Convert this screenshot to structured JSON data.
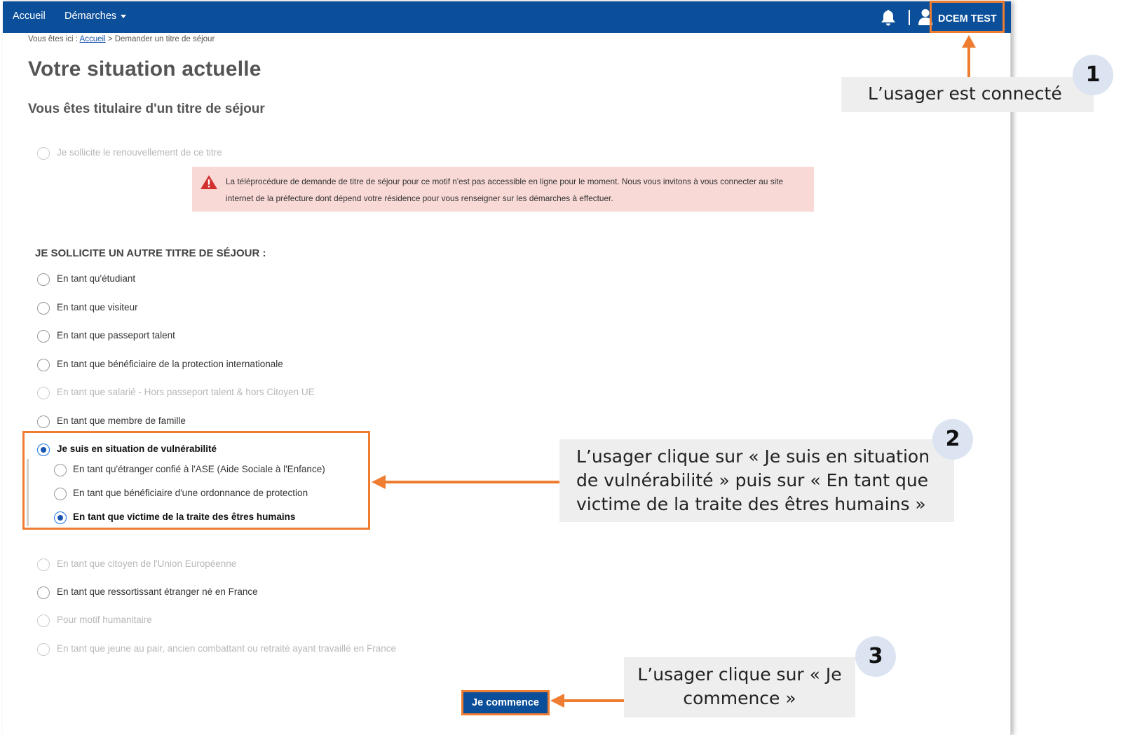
{
  "nav": {
    "accueil": "Accueil",
    "demarches": "Démarches",
    "user_name": "DCEM TEST"
  },
  "breadcrumb": {
    "prefix": "Vous êtes ici :",
    "home_link": "Accueil",
    "current": "> Demander un titre de séjour"
  },
  "page_title": "Votre situation actuelle",
  "section_title": "Vous êtes titulaire d'un titre de séjour",
  "renewal_option": "Je sollicite le renouvellement de ce titre",
  "alert_text": "La téléprocédure de demande de titre de séjour pour ce motif n'est pas accessible en ligne pour le moment. Nous vous invitons à vous connecter au site internet de la préfecture dont dépend votre résidence pour vous renseigner sur les démarches à effectuer.",
  "other_title": "JE SOLLICITE UN AUTRE TITRE DE SÉJOUR :",
  "options": [
    {
      "label": "En tant qu'étudiant",
      "state": "enabled"
    },
    {
      "label": "En tant que visiteur",
      "state": "enabled"
    },
    {
      "label": "En tant que passeport talent",
      "state": "enabled"
    },
    {
      "label": "En tant que bénéficiaire de la protection internationale",
      "state": "enabled"
    },
    {
      "label": "En tant que salarié - Hors passeport talent & hors Citoyen UE",
      "state": "disabled"
    },
    {
      "label": "En tant que membre de famille",
      "state": "enabled"
    },
    {
      "label": "Je suis en situation de vulnérabilité",
      "state": "checked"
    }
  ],
  "sub_options": [
    {
      "label": "En tant qu'étranger confié à l'ASE (Aide Sociale à l'Enfance)",
      "state": "enabled"
    },
    {
      "label": "En tant que bénéficiaire d'une ordonnance de protection",
      "state": "enabled"
    },
    {
      "label": "En tant que victime de la traite des êtres humains",
      "state": "checked"
    }
  ],
  "options_after": [
    {
      "label": "En tant que citoyen de l'Union Européenne",
      "state": "disabled"
    },
    {
      "label": "En tant que ressortissant étranger né en France",
      "state": "enabled"
    },
    {
      "label": "Pour motif humanitaire",
      "state": "disabled"
    },
    {
      "label": "En tant que jeune au pair, ancien combattant ou retraité ayant travaillé en France",
      "state": "disabled"
    }
  ],
  "start_button": "Je commence",
  "annotations": {
    "callout_1": "L’usager est connecté",
    "badge_1": "1",
    "callout_2_line1": "L’usager clique sur « Je suis en situation",
    "callout_2_line2": "de vulnérabilité » puis sur « En tant que",
    "callout_2_line3": "victime de la traite des êtres humains »",
    "badge_2": "2",
    "callout_3_line1": "L’usager clique sur « Je",
    "callout_3_line2": "commence »",
    "badge_3": "3"
  },
  "colors": {
    "navbar": "#0b4f9a",
    "highlight": "#ee7d31",
    "alert_bg": "#f8d9d6",
    "alert_icon": "#d32f2f",
    "callout_bg": "#eeeeee",
    "badge_bg": "#dce4f2"
  }
}
